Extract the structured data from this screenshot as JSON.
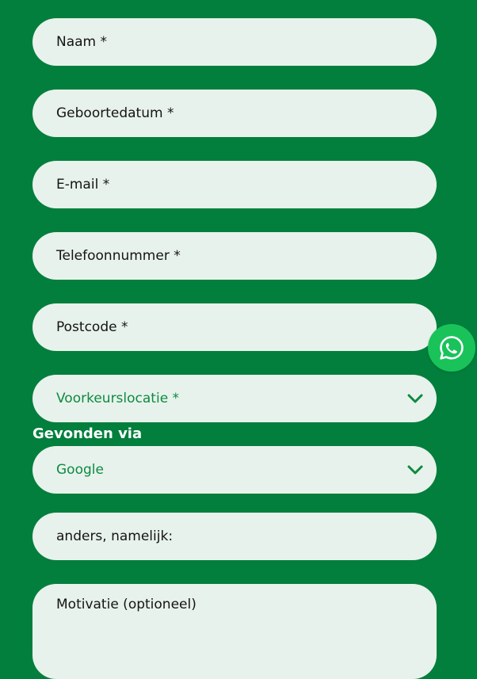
{
  "form": {
    "naam_placeholder": "Naam *",
    "geboortedatum_placeholder": "Geboortedatum *",
    "email_placeholder": "E-mail *",
    "telefoon_placeholder": "Telefoonnummer *",
    "postcode_placeholder": "Postcode *",
    "voorkeurslocatie_placeholder": "Voorkeurslocatie *",
    "gevonden_via_label": "Gevonden via",
    "gevonden_via_selected": "Google",
    "anders_placeholder": "anders, namelijk:",
    "motivatie_placeholder": "Motivatie (optioneel)"
  },
  "icons": {
    "select_chevron": "chevron-down-icon",
    "whatsapp": "whatsapp-icon"
  },
  "colors": {
    "background": "#027f3c",
    "field_background": "#e8f2ec",
    "select_text": "#0d8a41",
    "whatsapp_button": "#19c35a"
  }
}
